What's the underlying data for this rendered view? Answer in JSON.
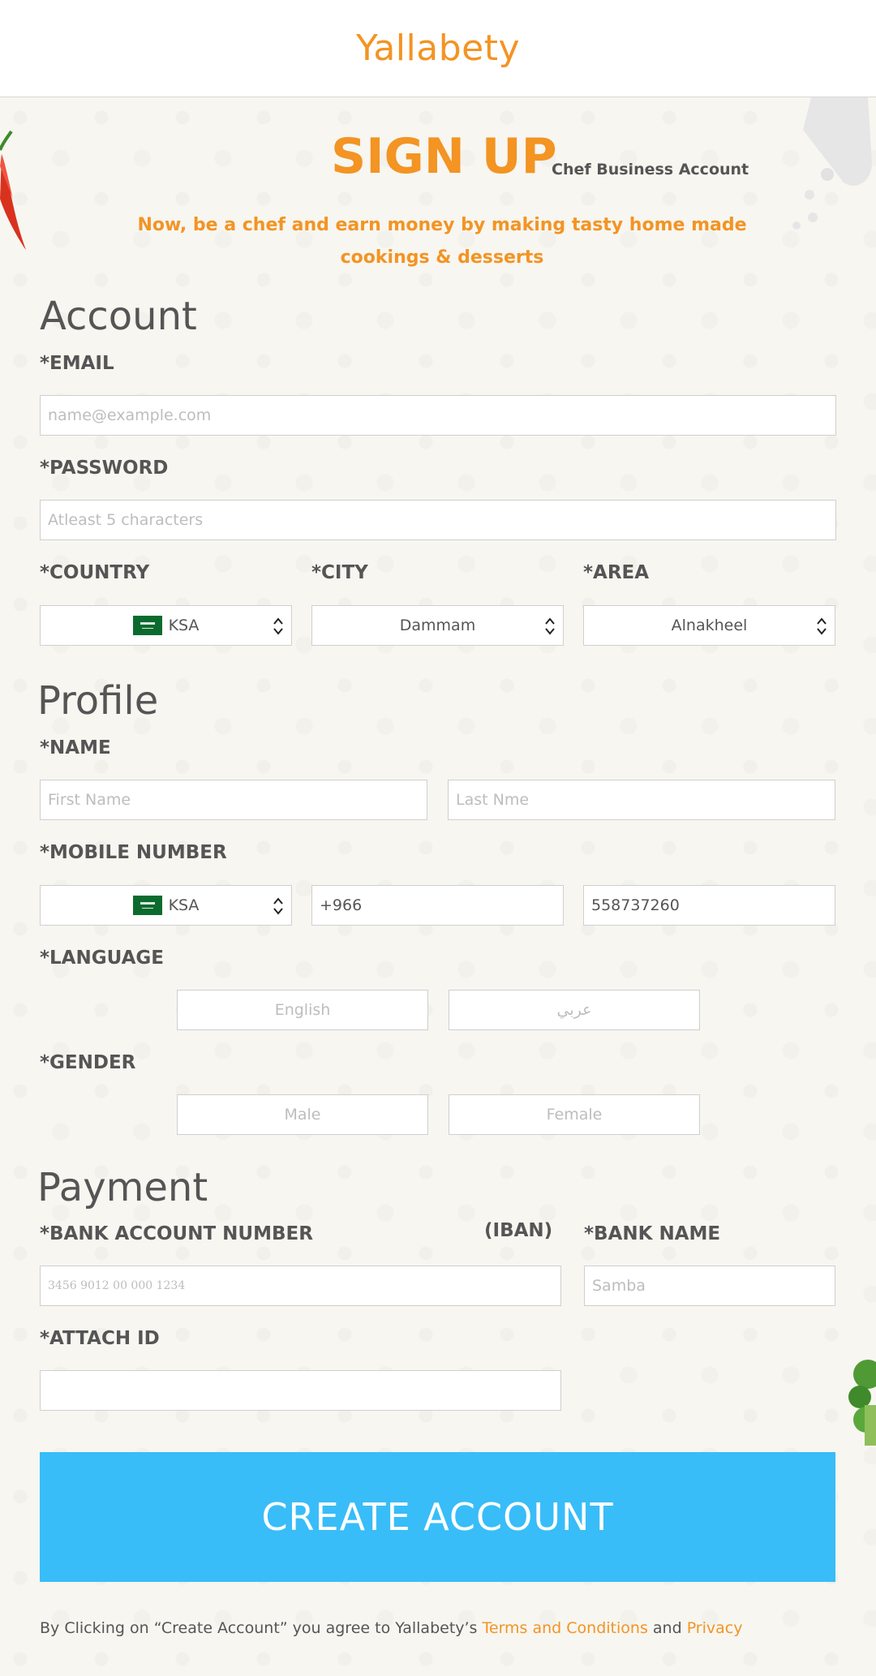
{
  "header": {
    "brand": "Yallabety"
  },
  "hero": {
    "title": "SIGN UP",
    "subtitle": "Chef Business Account",
    "tagline": "Now, be a chef and earn money by making tasty home made cookings & desserts"
  },
  "account": {
    "heading": "Account",
    "email_label": "*EMAIL",
    "email_placeholder": "name@example.com",
    "password_label": "*PASSWORD",
    "password_placeholder": "Atleast 5 characters",
    "country_label": "*COUNTRY",
    "country_value": "KSA",
    "city_label": "*CITY",
    "city_value": "Dammam",
    "area_label": "*AREA",
    "area_value": "Alnakheel"
  },
  "profile": {
    "heading": "Profile",
    "name_label": "*NAME",
    "first_name_placeholder": "First Name",
    "last_name_placeholder": "Last Nme",
    "mobile_label": "*MOBILE NUMBER",
    "mobile_country": "KSA",
    "mobile_code": "+966",
    "mobile_number": "558737260",
    "language_label": "*LANGUAGE",
    "language_options": [
      "English",
      "عربي"
    ],
    "gender_label": "*GENDER",
    "gender_options": [
      "Male",
      "Female"
    ]
  },
  "payment": {
    "heading": "Payment",
    "bank_account_label": "*BANK ACCOUNT NUMBER",
    "iban_label": "(IBAN)",
    "bank_account_placeholder": "3456 9012 00 000 1234",
    "bank_name_label": "*BANK NAME",
    "bank_name_placeholder": "Samba",
    "attach_label": "*ATTACH ID"
  },
  "actions": {
    "create_label": "CREATE ACCOUNT"
  },
  "footer": {
    "text_before": "By Clicking on “Create Account” you agree  to Yallabety’s ",
    "terms_link": "Terms and Conditions",
    "and_text": "and",
    "privacy_link": "Privacy"
  },
  "colors": {
    "brand_orange": "#f39423",
    "button_blue": "#38bdf8",
    "flag_green": "#0b6b2e"
  },
  "icons": [
    "chili-pepper-icon",
    "salt-shaker-icon",
    "broccoli-icon",
    "ksa-flag-icon",
    "select-arrows-icon"
  ]
}
